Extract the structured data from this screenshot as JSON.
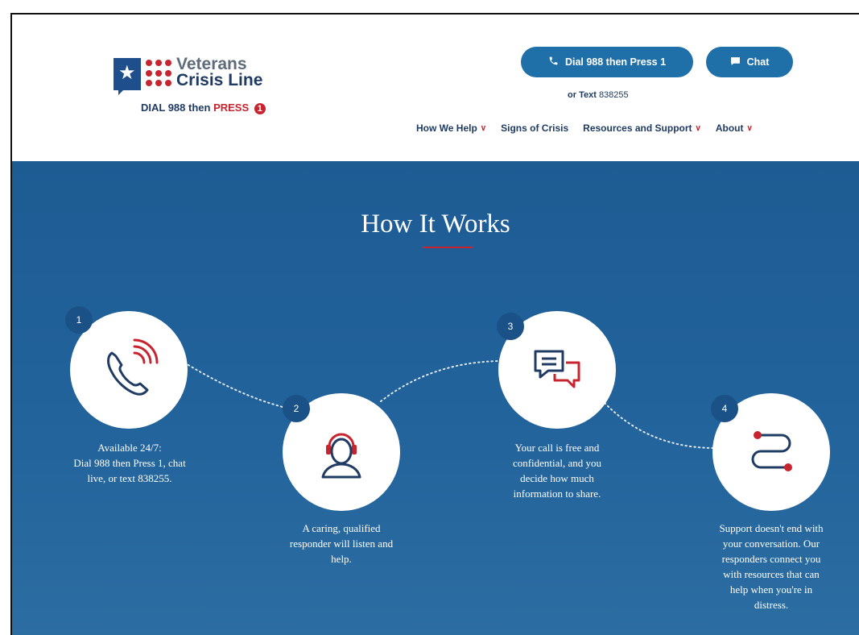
{
  "header": {
    "logo": {
      "name_line1": "Veterans",
      "name_line2": "Crisis Line",
      "tagline_prefix": "DIAL 988 then",
      "tagline_press": "PRESS",
      "tagline_digit": "1"
    },
    "dial_button": {
      "label": "Dial 988 then Press 1",
      "icon": "phone-icon"
    },
    "chat_button": {
      "label": "Chat",
      "icon": "chat-bubble-icon"
    },
    "text_line": {
      "prefix": "or",
      "bold": "Text",
      "number": "838255"
    },
    "nav": [
      {
        "label": "How We Help",
        "has_dropdown": true
      },
      {
        "label": "Signs of Crisis",
        "has_dropdown": false
      },
      {
        "label": "Resources and Support",
        "has_dropdown": true
      },
      {
        "label": "About",
        "has_dropdown": true
      }
    ]
  },
  "section": {
    "title": "How It Works",
    "steps": [
      {
        "number": "1",
        "icon": "phone-ringing-icon",
        "lines": [
          "Available 24/7:",
          "Dial 988 then Press 1, chat",
          "live, or text 838255."
        ]
      },
      {
        "number": "2",
        "icon": "headset-person-icon",
        "lines": [
          "A caring, qualified",
          "responder will listen and",
          "help."
        ]
      },
      {
        "number": "3",
        "icon": "chat-bubbles-icon",
        "lines": [
          "Your call is free and",
          "confidential, and you",
          "decide how much",
          "information to share."
        ]
      },
      {
        "number": "4",
        "icon": "path-connector-icon",
        "lines": [
          "Support doesn't end with",
          "your conversation. Our",
          "responders connect you",
          "with resources that can",
          "help when you're in",
          "distress."
        ]
      }
    ]
  },
  "colors": {
    "brand_blue": "#1f6fa8",
    "navy": "#1f3b63",
    "accent_red": "#c8242f",
    "section_blue": "#1d5b93"
  }
}
